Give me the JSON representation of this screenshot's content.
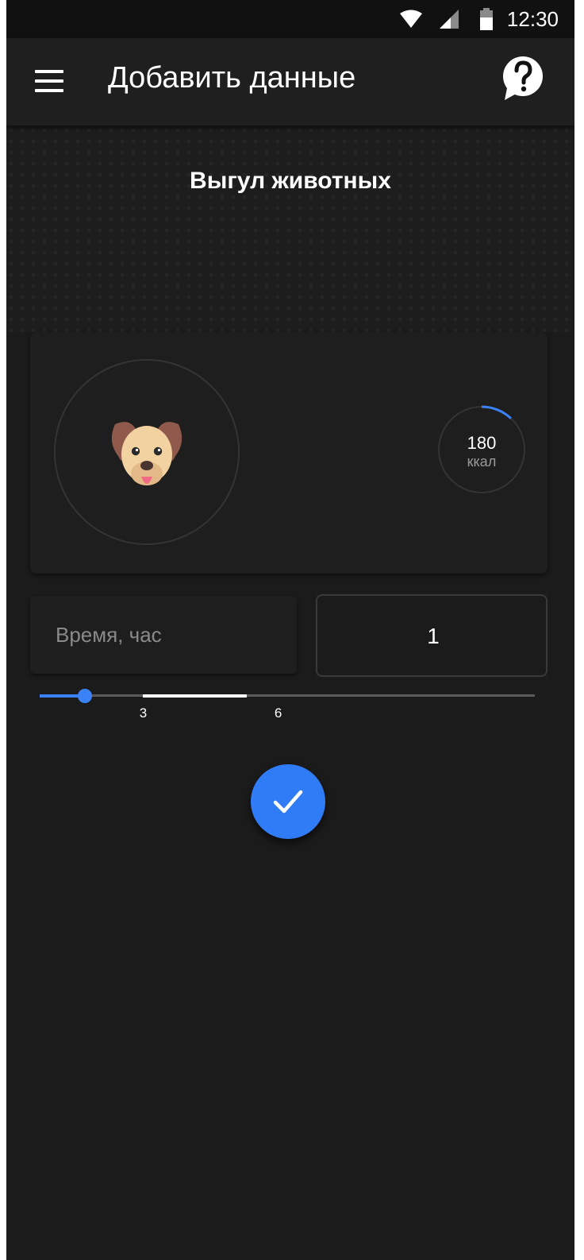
{
  "status_bar": {
    "time": "12:30",
    "icons": [
      "wifi-icon",
      "signal-icon",
      "battery-icon"
    ]
  },
  "app_bar": {
    "title": "Добавить данные",
    "menu_icon": "hamburger-menu-icon",
    "help_icon": "help-bubble-icon"
  },
  "activity": {
    "title": "Выгул животных",
    "icon": "dog-face-icon"
  },
  "calories": {
    "value": "180",
    "unit": "ккал",
    "progress_fraction": 0.12
  },
  "time_field": {
    "label": "Время, час",
    "value": "1"
  },
  "slider": {
    "min": 0,
    "max": 11,
    "value": 1,
    "highlight_range": [
      2.3,
      4.6
    ],
    "tick_labels": [
      "3",
      "6"
    ]
  },
  "fab": {
    "icon": "checkmark-icon"
  },
  "colors": {
    "accent": "#2f7cf6",
    "background": "#1b1b1b",
    "surface": "#1e1e1e"
  }
}
